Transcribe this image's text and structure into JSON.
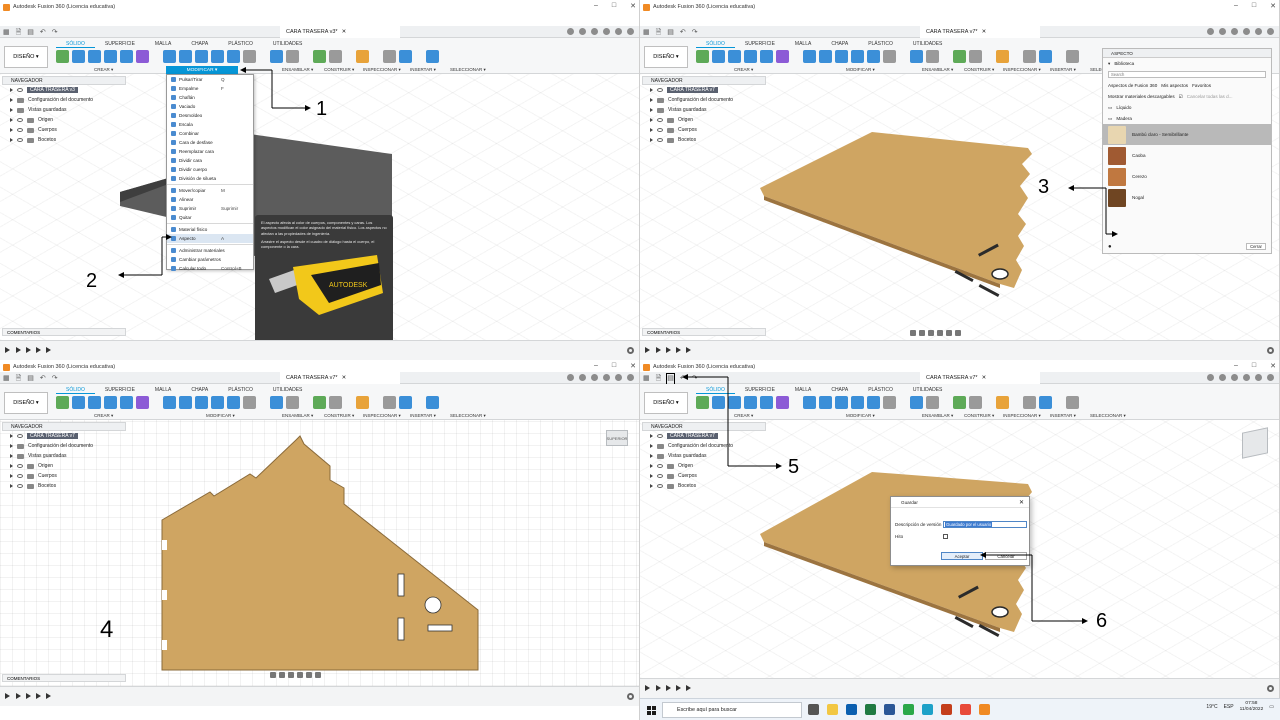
{
  "app_title": "Autodesk Fusion 360 (Licencia educativa)",
  "ribbon": {
    "workspace_button": "DISEÑO ▾",
    "tabs": [
      "SÓLIDO",
      "SUPERFICIE",
      "MALLA",
      "CHAPA",
      "PLÁSTICO",
      "UTILIDADES"
    ],
    "groups": [
      "CREAR ▾",
      "MODIFICAR ▾",
      "ENSAMBLAR ▾",
      "CONSTRUIR ▾",
      "INSPECCIONAR ▾",
      "INSERTAR ▾",
      "SELECCIONAR ▾"
    ]
  },
  "panels": [
    {
      "doc_tab": "CARA TRASERA v3*",
      "root_name": "CARA TRASERA v3"
    },
    {
      "doc_tab": "CARA TRASERA v7*",
      "root_name": "CARA TRASERA v7"
    },
    {
      "doc_tab": "CARA TRASERA v7*",
      "root_name": "CARA TRASERA v7"
    },
    {
      "doc_tab": "CARA TRASERA v7*",
      "root_name": "CARA TRASERA v7"
    }
  ],
  "navigator": {
    "title": "NAVEGADOR",
    "items": [
      "Configuración del documento",
      "Vistas guardadas",
      "Origen",
      "Cuerpos",
      "Bocetos"
    ]
  },
  "comments_label": "COMENTARIOS",
  "modify_menu": {
    "title": "MODIFICAR ▾",
    "items": [
      {
        "label": "Pulsar/Tirar",
        "shortcut": "Q"
      },
      {
        "label": "Empalme",
        "shortcut": "F"
      },
      {
        "label": "Chaflán",
        "shortcut": ""
      },
      {
        "label": "Vaciado",
        "shortcut": ""
      },
      {
        "label": "Desmoldeo",
        "shortcut": ""
      },
      {
        "label": "Escala",
        "shortcut": ""
      },
      {
        "label": "Combinar",
        "shortcut": ""
      },
      {
        "label": "Cara de desfase",
        "shortcut": ""
      },
      {
        "label": "Reemplazar cara",
        "shortcut": ""
      },
      {
        "label": "Dividir cara",
        "shortcut": ""
      },
      {
        "label": "Dividir cuerpo",
        "shortcut": ""
      },
      {
        "label": "División de silueta",
        "shortcut": ""
      },
      {
        "label": "Mover/copiar",
        "shortcut": "M"
      },
      {
        "label": "Alinear",
        "shortcut": ""
      },
      {
        "label": "Suprimir",
        "shortcut": "Suprimir"
      },
      {
        "label": "Quitar",
        "shortcut": ""
      },
      {
        "label": "Material físico",
        "shortcut": ""
      },
      {
        "label": "Aspecto",
        "shortcut": "A"
      },
      {
        "label": "Administrar materiales",
        "shortcut": ""
      },
      {
        "label": "Cambiar parámetros",
        "shortcut": ""
      },
      {
        "label": "Calcular todo",
        "shortcut": "Control+B"
      }
    ]
  },
  "tooltip": {
    "text1": "El aspecto afecta al color de cuerpos, componentes y caras. Los aspectos modifican el color asignado del material físico. Los aspectos no afectan a las propiedades de ingeniería.",
    "text2": "Arrastre el aspecto desde el cuadro de diálogo hasta el cuerpo, el componente o la cara.",
    "hint": "Pulse Ctrl+/ para obtener más ayuda.",
    "logo": "AUTODESK"
  },
  "aspect_panel": {
    "title": "ASPECTO",
    "library": "Biblioteca",
    "search_placeholder": "Search",
    "tabs": [
      "Aspectos de Fusion 360",
      "Mis aspectos",
      "Favoritos"
    ],
    "downloadable": "Mostrar materiales descargables",
    "cancel_all": "Cancelar todas las d...",
    "folders": [
      "Líquido",
      "Madera"
    ],
    "materials": [
      {
        "name": "Bambú claro - Semibrillante",
        "color": "#e8d6b0"
      },
      {
        "name": "Caoba",
        "color": "#a05a32"
      },
      {
        "name": "Cerezo",
        "color": "#c07840"
      },
      {
        "name": "Nogal",
        "color": "#6f4522"
      }
    ],
    "close": "Cerrar"
  },
  "save_dialog": {
    "title": "Guardar",
    "desc_label": "Descripción de versión",
    "desc_value": "Guardado por el usuario",
    "milestone_label": "Hito",
    "ok": "Aceptar",
    "cancel": "Cancelar"
  },
  "callouts": [
    "1",
    "2",
    "3",
    "4",
    "5",
    "6"
  ],
  "view_cube_label": "SUPERIOR",
  "taskbar": {
    "search": "Escribe aquí para buscar",
    "weather": "19°C",
    "lang": "ESP",
    "time": "07:58",
    "date": "11/04/2022"
  },
  "colors": {
    "accent": "#0696d7",
    "wood": "#cfa562",
    "dark_body": "#5c5c5c"
  }
}
